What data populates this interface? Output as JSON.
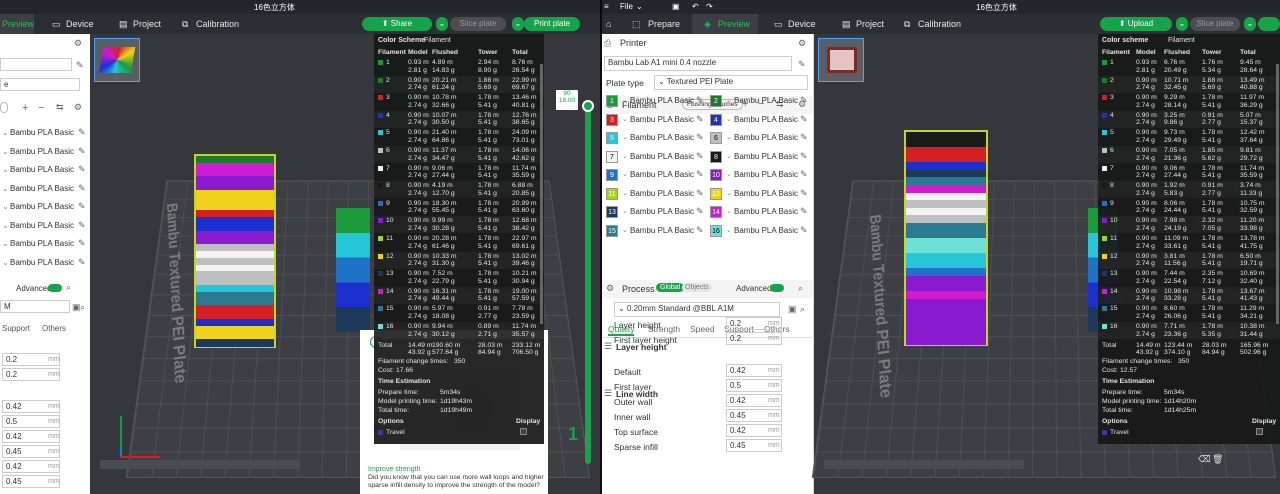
{
  "window_title": "16色立方体",
  "left": {
    "tabs": {
      "preview": "Preview",
      "device": "Device",
      "project": "Project",
      "calibration": "Calibration"
    },
    "share_label": "Share",
    "slice_label": "Slice plate",
    "print_label": "Print plate",
    "plate_text": "Bambu Textured PEI Plate",
    "field_lower_e": "e",
    "advanced_label": "Advanced",
    "profile_m": "M",
    "tabs2": {
      "support": "Support",
      "others": "Others"
    },
    "filament_label": "Bambu PLA Basic",
    "values": [
      "0.2",
      "0.2",
      "0.42",
      "0.5",
      "0.42",
      "0.45",
      "0.42",
      "0.45"
    ],
    "unit": "mm",
    "slider_top": "90",
    "slider_sub": "18.00",
    "slider_bottom": "1",
    "tip_title": "Improve strength",
    "tip_text": "Did you know that you can use more wall loops and higher sparse infill density to improve the strength of the model?"
  },
  "right": {
    "file_label": "File",
    "tabs": {
      "prepare": "Prepare",
      "preview": "Preview",
      "device": "Device",
      "project": "Project",
      "calibration": "Calibration"
    },
    "upload_label": "Upload",
    "slice_label": "Slice plate",
    "printer_heading": "Printer",
    "printer_name": "Bambu Lab A1 mini 0.4 nozzle",
    "plate_type_label": "Plate type",
    "plate_type_value": "Textured PEI Plate",
    "filament_heading": "Filament",
    "flushing_label": "Flushing volumes",
    "process_heading": "Process",
    "global_label": "Global",
    "objects_label": "Objects",
    "advanced_label": "Advanced",
    "profile_name": "0.20mm Standard @BBL A1M",
    "process_tabs": {
      "quality": "Quality",
      "strength": "Strength",
      "speed": "Speed",
      "support": "Support",
      "others": "Others"
    },
    "layer_height_heading": "Layer height",
    "line_width_heading": "Line width",
    "settings": [
      {
        "label": "Layer height",
        "value": "0.2"
      },
      {
        "label": "First layer height",
        "value": "0.2"
      },
      {
        "label": "Default",
        "value": "0.42"
      },
      {
        "label": "First layer",
        "value": "0.5"
      },
      {
        "label": "Outer wall",
        "value": "0.42"
      },
      {
        "label": "Inner wall",
        "value": "0.45"
      },
      {
        "label": "Top surface",
        "value": "0.42"
      },
      {
        "label": "Sparse infill",
        "value": "0.45"
      }
    ],
    "unit": "mm",
    "plate_text": "Bambu Textured PEI Plate"
  },
  "filaments": [
    {
      "n": "1",
      "name": "Bambu PLA Basic",
      "color": "#1a9a3a"
    },
    {
      "n": "2",
      "name": "Bambu PLA Basic",
      "color": "#1c7a2c"
    },
    {
      "n": "3",
      "name": "Bambu PLA Basic",
      "color": "#d41f25"
    },
    {
      "n": "4",
      "name": "Bambu PLA Basic",
      "color": "#1c2fd1"
    },
    {
      "n": "5",
      "name": "Bambu PLA Basic",
      "color": "#25c6d8"
    },
    {
      "n": "6",
      "name": "Bambu PLA Basic",
      "color": "#bfbfbf"
    },
    {
      "n": "7",
      "name": "Bambu PLA Basic",
      "color": "#f3f3f3"
    },
    {
      "n": "8",
      "name": "Bambu PLA Basic",
      "color": "#1a1a1a"
    },
    {
      "n": "9",
      "name": "Bambu PLA Basic",
      "color": "#1e73c9"
    },
    {
      "n": "10",
      "name": "Bambu PLA Basic",
      "color": "#8a1ad0"
    },
    {
      "n": "11",
      "name": "Bambu PLA Basic",
      "color": "#a7d41a"
    },
    {
      "n": "12",
      "name": "Bambu PLA Basic",
      "color": "#f0d21a"
    },
    {
      "n": "13",
      "name": "Bambu PLA Basic",
      "color": "#1d3a5a"
    },
    {
      "n": "14",
      "name": "Bambu PLA Basic",
      "color": "#d21ad0"
    },
    {
      "n": "15",
      "name": "Bambu PLA Basic",
      "color": "#2a7a92"
    },
    {
      "n": "16",
      "name": "Bambu PLA Basic",
      "color": "#6fe0d6"
    }
  ],
  "color_scheme": {
    "title": "Color Scheme",
    "title_right": "Color scheme",
    "mode": "Filament",
    "headers": [
      "Filament",
      "Model",
      "Flushed",
      "Tower",
      "Total"
    ],
    "left_rows": [
      [
        "1",
        "0.93 m",
        "4.89 m",
        "2.94 m",
        "8.76 m",
        "2.81 g",
        "14.83 g",
        "8.90 g",
        "26.54 g"
      ],
      [
        "2",
        "0.90 m",
        "20.21 m",
        "1.88 m",
        "22.99 m",
        "2.74 g",
        "61.24 g",
        "5.69 g",
        "69.67 g"
      ],
      [
        "3",
        "0.90 m",
        "10.78 m",
        "1.78 m",
        "13.46 m",
        "2.74 g",
        "32.66 g",
        "5.41 g",
        "40.81 g"
      ],
      [
        "4",
        "0.90 m",
        "10.07 m",
        "1.78 m",
        "12.76 m",
        "2.74 g",
        "30.50 g",
        "5.41 g",
        "38.65 g"
      ],
      [
        "5",
        "0.90 m",
        "21.40 m",
        "1.78 m",
        "24.09 m",
        "2.74 g",
        "64.86 g",
        "5.41 g",
        "73.01 g"
      ],
      [
        "6",
        "0.90 m",
        "11.37 m",
        "1.78 m",
        "14.06 m",
        "2.74 g",
        "34.47 g",
        "5.41 g",
        "42.62 g"
      ],
      [
        "7",
        "0.90 m",
        "9.06 m",
        "1.78 m",
        "11.74 m",
        "2.74 g",
        "27.44 g",
        "5.41 g",
        "35.59 g"
      ],
      [
        "8",
        "0.90 m",
        "4.19 m",
        "1.78 m",
        "6.88 m",
        "2.74 g",
        "12.70 g",
        "5.41 g",
        "20.85 g"
      ],
      [
        "9",
        "0.90 m",
        "18.30 m",
        "1.78 m",
        "20.99 m",
        "2.74 g",
        "55.45 g",
        "5.41 g",
        "63.60 g"
      ],
      [
        "10",
        "0.90 m",
        "9.99 m",
        "1.78 m",
        "12.68 m",
        "2.74 g",
        "30.28 g",
        "5.41 g",
        "38.42 g"
      ],
      [
        "11",
        "0.90 m",
        "20.28 m",
        "1.78 m",
        "22.97 m",
        "2.74 g",
        "61.46 g",
        "5.41 g",
        "69.61 g"
      ],
      [
        "12",
        "0.90 m",
        "10.33 m",
        "1.78 m",
        "13.02 m",
        "2.74 g",
        "31.30 g",
        "5.41 g",
        "39.46 g"
      ],
      [
        "13",
        "0.90 m",
        "7.52 m",
        "1.78 m",
        "10.21 m",
        "2.74 g",
        "22.79 g",
        "5.41 g",
        "30.94 g"
      ],
      [
        "14",
        "0.90 m",
        "16.31 m",
        "1.78 m",
        "19.00 m",
        "2.74 g",
        "49.44 g",
        "5.41 g",
        "57.59 g"
      ],
      [
        "15",
        "0.90 m",
        "5.97 m",
        "0.91 m",
        "7.78 m",
        "2.74 g",
        "18.08 g",
        "2.77 g",
        "23.59 g"
      ],
      [
        "16",
        "0.90 m",
        "9.94 m",
        "0.89 m",
        "11.74 m",
        "2.74 g",
        "30.12 g",
        "2.71 g",
        "35.57 g"
      ]
    ],
    "left_total": [
      "Total",
      "14.49 m",
      "190.60 m",
      "28.03 m",
      "233.12 m",
      "43.92 g",
      "577.64 g",
      "84.94 g",
      "706.50 g"
    ],
    "right_rows": [
      [
        "1",
        "0.93 m",
        "6.76 m",
        "1.76 m",
        "9.45 m",
        "2.81 g",
        "20.49 g",
        "5.34 g",
        "28.64 g"
      ],
      [
        "2",
        "0.90 m",
        "10.71 m",
        "1.88 m",
        "13.49 m",
        "2.74 g",
        "32.45 g",
        "5.69 g",
        "40.88 g"
      ],
      [
        "3",
        "0.90 m",
        "9.29 m",
        "1.78 m",
        "11.97 m",
        "2.74 g",
        "28.14 g",
        "5.41 g",
        "36.29 g"
      ],
      [
        "4",
        "0.90 m",
        "3.25 m",
        "0.91 m",
        "5.07 m",
        "2.74 g",
        "9.86 g",
        "2.77 g",
        "15.37 g"
      ],
      [
        "5",
        "0.90 m",
        "9.73 m",
        "1.78 m",
        "12.42 m",
        "2.74 g",
        "29.49 g",
        "5.41 g",
        "37.64 g"
      ],
      [
        "6",
        "0.90 m",
        "7.05 m",
        "1.85 m",
        "9.81 m",
        "2.74 g",
        "21.36 g",
        "5.62 g",
        "29.72 g"
      ],
      [
        "7",
        "0.90 m",
        "9.06 m",
        "1.78 m",
        "11.74 m",
        "2.74 g",
        "27.44 g",
        "5.41 g",
        "35.59 g"
      ],
      [
        "8",
        "0.90 m",
        "1.92 m",
        "0.91 m",
        "3.74 m",
        "2.74 g",
        "5.83 g",
        "2.77 g",
        "11.33 g"
      ],
      [
        "9",
        "0.90 m",
        "8.06 m",
        "1.78 m",
        "10.75 m",
        "2.74 g",
        "24.44 g",
        "5.41 g",
        "32.59 g"
      ],
      [
        "10",
        "0.90 m",
        "7.98 m",
        "2.32 m",
        "11.20 m",
        "2.74 g",
        "24.19 g",
        "7.05 g",
        "33.98 g"
      ],
      [
        "11",
        "0.90 m",
        "11.09 m",
        "1.78 m",
        "13.78 m",
        "2.74 g",
        "33.61 g",
        "5.41 g",
        "41.75 g"
      ],
      [
        "12",
        "0.90 m",
        "3.81 m",
        "1.78 m",
        "6.50 m",
        "2.74 g",
        "11.56 g",
        "5.41 g",
        "19.71 g"
      ],
      [
        "13",
        "0.90 m",
        "7.44 m",
        "2.35 m",
        "10.69 m",
        "2.74 g",
        "22.54 g",
        "7.12 g",
        "32.40 g"
      ],
      [
        "14",
        "0.90 m",
        "10.98 m",
        "1.78 m",
        "13.67 m",
        "2.74 g",
        "33.28 g",
        "5.41 g",
        "41.43 g"
      ],
      [
        "15",
        "0.90 m",
        "8.60 m",
        "1.78 m",
        "11.29 m",
        "2.74 g",
        "26.06 g",
        "5.41 g",
        "34.21 g"
      ],
      [
        "16",
        "0.90 m",
        "7.71 m",
        "1.78 m",
        "10.38 m",
        "2.74 g",
        "23.36 g",
        "5.35 g",
        "31.44 g"
      ]
    ],
    "right_total": [
      "Total",
      "14.49 m",
      "123.44 m",
      "28.03 m",
      "165.96 m",
      "43.92 g",
      "374.10 g",
      "84.94 g",
      "502.96 g"
    ],
    "change_times_label": "Filament change times:",
    "left_change_times": "350",
    "right_change_times": "350",
    "cost_label": "Cost:",
    "left_cost": "17.66",
    "right_cost": "12.57",
    "time_heading": "Time Estimation",
    "prepare_label": "Prepare time:",
    "prepare_time": "5m34s",
    "model_time_label": "Model printing time:",
    "left_model_time": "1d19h43m",
    "right_model_time": "1d14h20m",
    "total_time_label": "Total time:",
    "left_total_time": "1d19h49m",
    "right_total_time": "1d14h25m",
    "options_label": "Options",
    "display_label": "Display",
    "travel_label": "Travel"
  }
}
